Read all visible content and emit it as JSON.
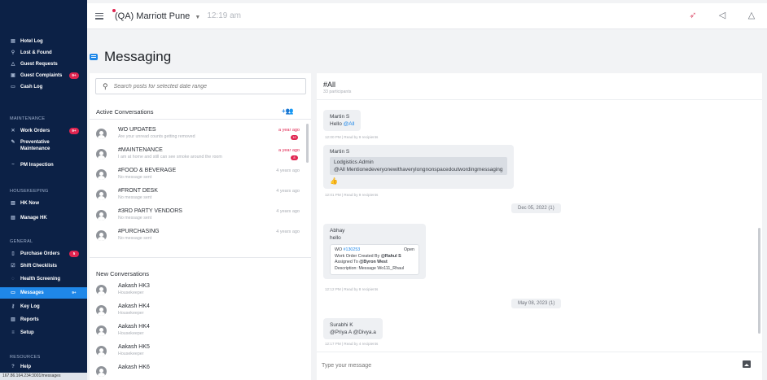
{
  "topbar": {
    "property": "(QA) Marriott Pune",
    "time": "12:19 am"
  },
  "sidebar": {
    "top_items": [
      {
        "label": "Hotel Log",
        "icon": "book-icon",
        "badge": ""
      },
      {
        "label": "Lost & Found",
        "icon": "search-icon",
        "badge": ""
      },
      {
        "label": "Guest Requests",
        "icon": "bell-icon",
        "badge": ""
      },
      {
        "label": "Guest Complaints",
        "icon": "complaint-icon",
        "badge": "9+"
      },
      {
        "label": "Cash Log",
        "icon": "cash-icon",
        "badge": ""
      }
    ],
    "maintenance_label": "MAINTENANCE",
    "maintenance_items": [
      {
        "label": "Work Orders",
        "icon": "wrench-icon",
        "badge": "9+"
      },
      {
        "label": "Preventative",
        "label2": "Maintenance",
        "icon": "tools-icon",
        "badge": ""
      },
      {
        "label": "PM Inspection",
        "icon": "inspection-icon",
        "badge": ""
      }
    ],
    "housekeeping_label": "HOUSEKEEPING",
    "housekeeping_items": [
      {
        "label": "HK Now",
        "icon": "chart-icon",
        "badge": ""
      },
      {
        "label": "Manage HK",
        "icon": "chart-icon",
        "badge": ""
      }
    ],
    "general_label": "GENERAL",
    "general_items": [
      {
        "label": "Purchase Orders",
        "icon": "document-icon",
        "badge": "5"
      },
      {
        "label": "Shift Checklists",
        "icon": "checklist-icon",
        "badge": ""
      },
      {
        "label": "Health Screening",
        "icon": "shield-icon",
        "badge": ""
      },
      {
        "label": "Messages",
        "icon": "message-icon",
        "badge": "9+"
      },
      {
        "label": "Key Log",
        "icon": "key-icon",
        "badge": ""
      },
      {
        "label": "Reports",
        "icon": "chart-icon",
        "badge": ""
      },
      {
        "label": "Setup",
        "icon": "settings-icon",
        "badge": ""
      }
    ],
    "resources_label": "RESOURCES",
    "help_label": "Help",
    "url": "167.86.164.234:3001/messages"
  },
  "page": {
    "title": "Messaging"
  },
  "left": {
    "search_placeholder": "Search posts for selected date range",
    "active_header": "Active Conversations",
    "add_icon_text": "+👥",
    "active": [
      {
        "name": "WO UPDATES",
        "sub": "Are your unread counts getting removed",
        "time": "a year ago",
        "unread": true,
        "count": "10"
      },
      {
        "name": "#MAINTENANCE",
        "sub": "I am at home and still can see smoke around the room",
        "time": "a year ago",
        "unread": true,
        "count": "8"
      },
      {
        "name": "#FOOD & BEVERAGE",
        "sub": "No message sent",
        "time": "4 years ago",
        "unread": false,
        "count": ""
      },
      {
        "name": "#FRONT DESK",
        "sub": "No message sent",
        "time": "4 years ago",
        "unread": false,
        "count": ""
      },
      {
        "name": "#3RD PARTY VENDORS",
        "sub": "No message sent",
        "time": "4 years ago",
        "unread": false,
        "count": ""
      },
      {
        "name": "#PURCHASING",
        "sub": "No message sent",
        "time": "4 years ago",
        "unread": false,
        "count": ""
      }
    ],
    "new_header": "New Conversations",
    "new": [
      {
        "name": "Aakash HK3",
        "sub": "Housekeeper"
      },
      {
        "name": "Aakash HK4",
        "sub": "Housekeeper"
      },
      {
        "name": "Aakash HK4",
        "sub": "Housekeeper"
      },
      {
        "name": "Aakash HK5",
        "sub": "Housekeeper"
      },
      {
        "name": "Aakash HK6",
        "sub": ""
      }
    ]
  },
  "right": {
    "channel": "#All",
    "participants": "33 participants",
    "msg1": {
      "who": "Martin S",
      "pre": "Hello ",
      "mention": "@All",
      "meta": "12:00 PM | Read by 9 recipients"
    },
    "msg2": {
      "who": "Martin S",
      "quote_who": "Lodgistics Admin",
      "quote_text": "@All Mentionedeveryonewithaverylongnonspacedoutwordingmessaging",
      "thumbs": "👍",
      "meta": "12:01 PM | Read by 9 recipients"
    },
    "date1": "Dec 05, 2022 (1)",
    "msg3": {
      "who": "Abhay",
      "text": "hello",
      "wo_prefix": "WO ",
      "wo_number": "#130253",
      "wo_status": "Open",
      "line1a": "Work Order Created By ",
      "line1b": "@Rahul S",
      "line2a": "Assigned To ",
      "line2b": "@Byron West",
      "line3": "Description: Message Wo111_Rhaul",
      "meta": "12:12 PM | Read by 8 recipients"
    },
    "date2": "May 08, 2023 (1)",
    "msg4": {
      "who": "Surabhi K",
      "mention": "@Priya A @Divya.a",
      "meta": "12:17 PM | Read by 4 recipients"
    },
    "composer_placeholder": "Type your message"
  },
  "colors": {
    "sidebar_bg": "#0c2146",
    "accent": "#1f87e8",
    "badge": "#e02450"
  }
}
